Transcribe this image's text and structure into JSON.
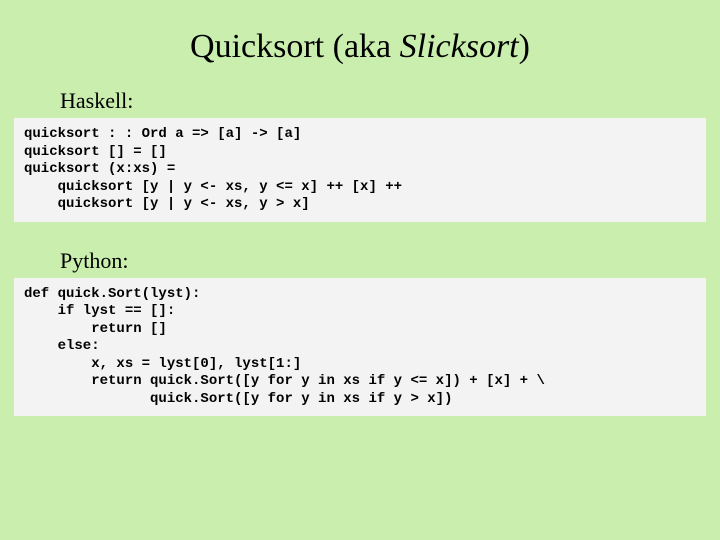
{
  "title": {
    "prefix": "Quicksort (aka ",
    "italic": "Slicksort",
    "suffix": ")"
  },
  "sections": {
    "haskell": {
      "label": "Haskell:",
      "code": "quicksort : : Ord a => [a] -> [a]\nquicksort [] = []\nquicksort (x:xs) =\n    quicksort [y | y <- xs, y <= x] ++ [x] ++\n    quicksort [y | y <- xs, y > x]"
    },
    "python": {
      "label": "Python:",
      "code": "def quick.Sort(lyst):\n    if lyst == []:\n        return []\n    else:\n        x, xs = lyst[0], lyst[1:]\n        return quick.Sort([y for y in xs if y <= x]) + [x] + \\\n               quick.Sort([y for y in xs if y > x])"
    }
  }
}
